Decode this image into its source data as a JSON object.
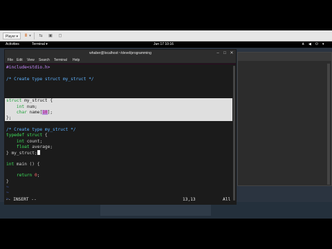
{
  "vm_toolbar": {
    "player_label": "Player ▾",
    "pause_icon": "pause-icon",
    "pause_arrow": "▾",
    "tool_icons": [
      "vm-network-icon",
      "vm-snapshot-icon",
      "vm-fullscreen-icon"
    ]
  },
  "gnome_bar": {
    "activities": "Activities",
    "app_menu": "Terminal ▾",
    "clock": "Jun 17  10:16",
    "tray": [
      "network-icon",
      "volume-icon",
      "power-icon",
      "menu-arrow-icon"
    ]
  },
  "terminal": {
    "title": "whaber@localhost:~/devel/programming",
    "menu": [
      "File",
      "Edit",
      "View",
      "Search",
      "Terminal",
      "Help"
    ]
  },
  "editor": {
    "lines": [
      "#include<stdio.h>",
      "",
      "/* Create type struct my_struct */",
      "struct my_struct {",
      "    int num;",
      "    char name[10];",
      "};",
      "",
      "/* Create type my_struct */",
      "typedef struct {",
      "    int count;",
      "    float average;",
      "} my_struct;",
      "",
      "int main () {",
      "",
      "    return 0;",
      "}",
      "~",
      "~",
      "~",
      "~",
      "~",
      "~"
    ]
  },
  "status": {
    "mode": "-- INSERT --",
    "position": "13,13",
    "scroll": "All"
  },
  "colors": {
    "comment": "#5fb3ff",
    "keyword": "#3ee05b",
    "preproc": "#c98bff",
    "number": "#ff6b6b",
    "tilde": "#4a6bd8",
    "selection_bg": "#dfdfdf"
  }
}
